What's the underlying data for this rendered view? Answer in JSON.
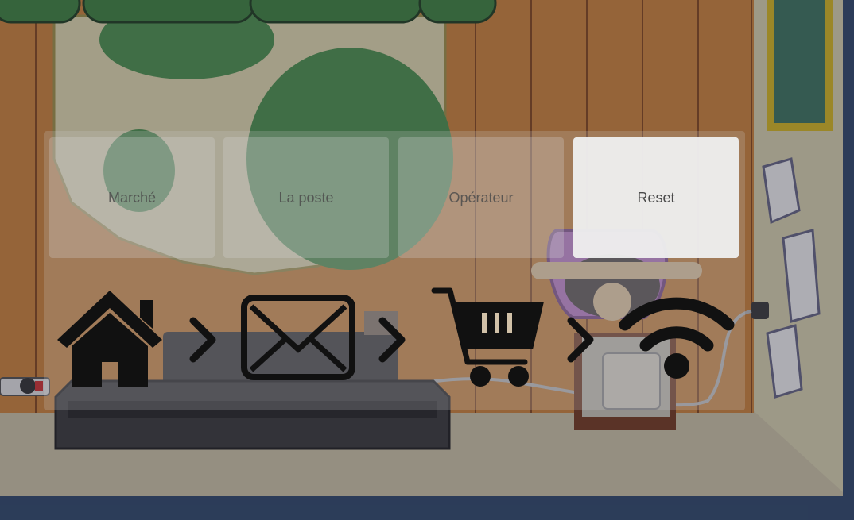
{
  "buttons": {
    "marche": "Marché",
    "la_poste": "La poste",
    "operateur": "Opérateur",
    "reset": "Reset"
  },
  "sequence": [
    "house-icon",
    "chevron-right-icon",
    "envelope-icon",
    "chevron-right-icon",
    "shopping-cart-icon",
    "chevron-right-icon",
    "wifi-icon"
  ],
  "colors": {
    "wall_wood": "#d98a3a",
    "wood_line": "#8a4a1c",
    "bush_green": "#4f9a4f",
    "map_cream": "#efe7b8",
    "frame_gold": "#e2c21f",
    "floor": "#d8cfae",
    "navy_border": "#2f4a6e",
    "icon_black": "#111111"
  }
}
